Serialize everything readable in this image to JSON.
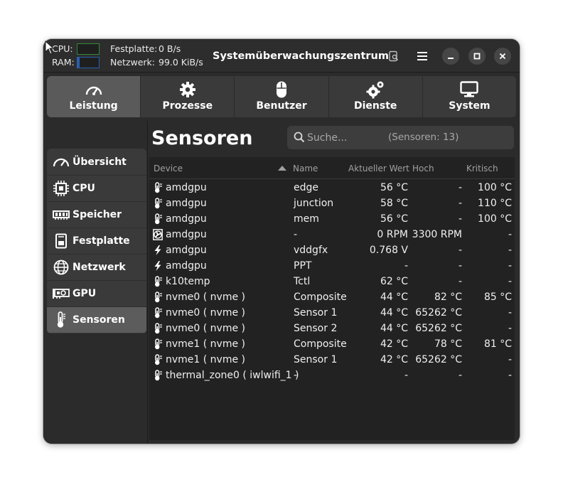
{
  "window": {
    "title": "Systemüberwachungszentrum"
  },
  "monitor": {
    "cpu_label": "CPU:",
    "ram_label": "RAM:",
    "disk_label": "Festplatte:",
    "disk_value": "0 B/s",
    "net_label": "Netzwerk:",
    "net_value": "99.0 KiB/s"
  },
  "tabs": [
    {
      "label": "Leistung",
      "icon": "gauge-icon",
      "active": true
    },
    {
      "label": "Prozesse",
      "icon": "gear-icon",
      "active": false
    },
    {
      "label": "Benutzer",
      "icon": "mouse-icon",
      "active": false
    },
    {
      "label": "Dienste",
      "icon": "gears-icon",
      "active": false
    },
    {
      "label": "System",
      "icon": "monitor-icon",
      "active": false
    }
  ],
  "sidebar": {
    "items": [
      {
        "label": "Übersicht",
        "icon": "gauge-icon"
      },
      {
        "label": "CPU",
        "icon": "chip-icon"
      },
      {
        "label": "Speicher",
        "icon": "ram-icon"
      },
      {
        "label": "Festplatte",
        "icon": "disk-icon"
      },
      {
        "label": "Netzwerk",
        "icon": "globe-icon"
      },
      {
        "label": "GPU",
        "icon": "gpu-icon"
      },
      {
        "label": "Sensoren",
        "icon": "thermometer-icon",
        "active": true
      }
    ]
  },
  "main": {
    "title": "Sensoren",
    "search_placeholder": "Suche...",
    "search_count": "(Sensoren: 13)"
  },
  "table": {
    "columns": {
      "device": "Device",
      "name": "Name",
      "current": "Aktueller Wert",
      "high": "Hoch",
      "critical": "Kritisch"
    },
    "rows": [
      {
        "icon": "thermometer-icon",
        "device": "amdgpu",
        "name": "edge",
        "current": "56 °C",
        "high": "-",
        "critical": "100 °C"
      },
      {
        "icon": "thermometer-icon",
        "device": "amdgpu",
        "name": "junction",
        "current": "58 °C",
        "high": "-",
        "critical": "110 °C"
      },
      {
        "icon": "thermometer-icon",
        "device": "amdgpu",
        "name": "mem",
        "current": "56 °C",
        "high": "-",
        "critical": "100 °C"
      },
      {
        "icon": "fan-icon",
        "device": "amdgpu",
        "name": "-",
        "current": "0 RPM",
        "high": "3300 RPM",
        "critical": "-"
      },
      {
        "icon": "lightning-icon",
        "device": "amdgpu",
        "name": "vddgfx",
        "current": "0.768 V",
        "high": "-",
        "critical": "-"
      },
      {
        "icon": "lightning-icon",
        "device": "amdgpu",
        "name": "PPT",
        "current": "-",
        "high": "-",
        "critical": "-"
      },
      {
        "icon": "thermometer-icon",
        "device": "k10temp",
        "name": "Tctl",
        "current": "62 °C",
        "high": "-",
        "critical": "-"
      },
      {
        "icon": "thermometer-icon",
        "device": "nvme0 ( nvme )",
        "name": "Composite",
        "current": "44 °C",
        "high": "82 °C",
        "critical": "85 °C"
      },
      {
        "icon": "thermometer-icon",
        "device": "nvme0 ( nvme )",
        "name": "Sensor 1",
        "current": "44 °C",
        "high": "65262 °C",
        "critical": "-"
      },
      {
        "icon": "thermometer-icon",
        "device": "nvme0 ( nvme )",
        "name": "Sensor 2",
        "current": "44 °C",
        "high": "65262 °C",
        "critical": "-"
      },
      {
        "icon": "thermometer-icon",
        "device": "nvme1 ( nvme )",
        "name": "Composite",
        "current": "42 °C",
        "high": "78 °C",
        "critical": "81 °C"
      },
      {
        "icon": "thermometer-icon",
        "device": "nvme1 ( nvme )",
        "name": "Sensor 1",
        "current": "42 °C",
        "high": "65262 °C",
        "critical": "-"
      },
      {
        "icon": "thermometer-icon",
        "device": "thermal_zone0 ( iwlwifi_1 )",
        "name": "-",
        "current": "-",
        "high": "-",
        "critical": "-"
      }
    ]
  },
  "colors": {
    "cpu_graph": "#2f8a3a",
    "ram_graph": "#2a5fae"
  }
}
